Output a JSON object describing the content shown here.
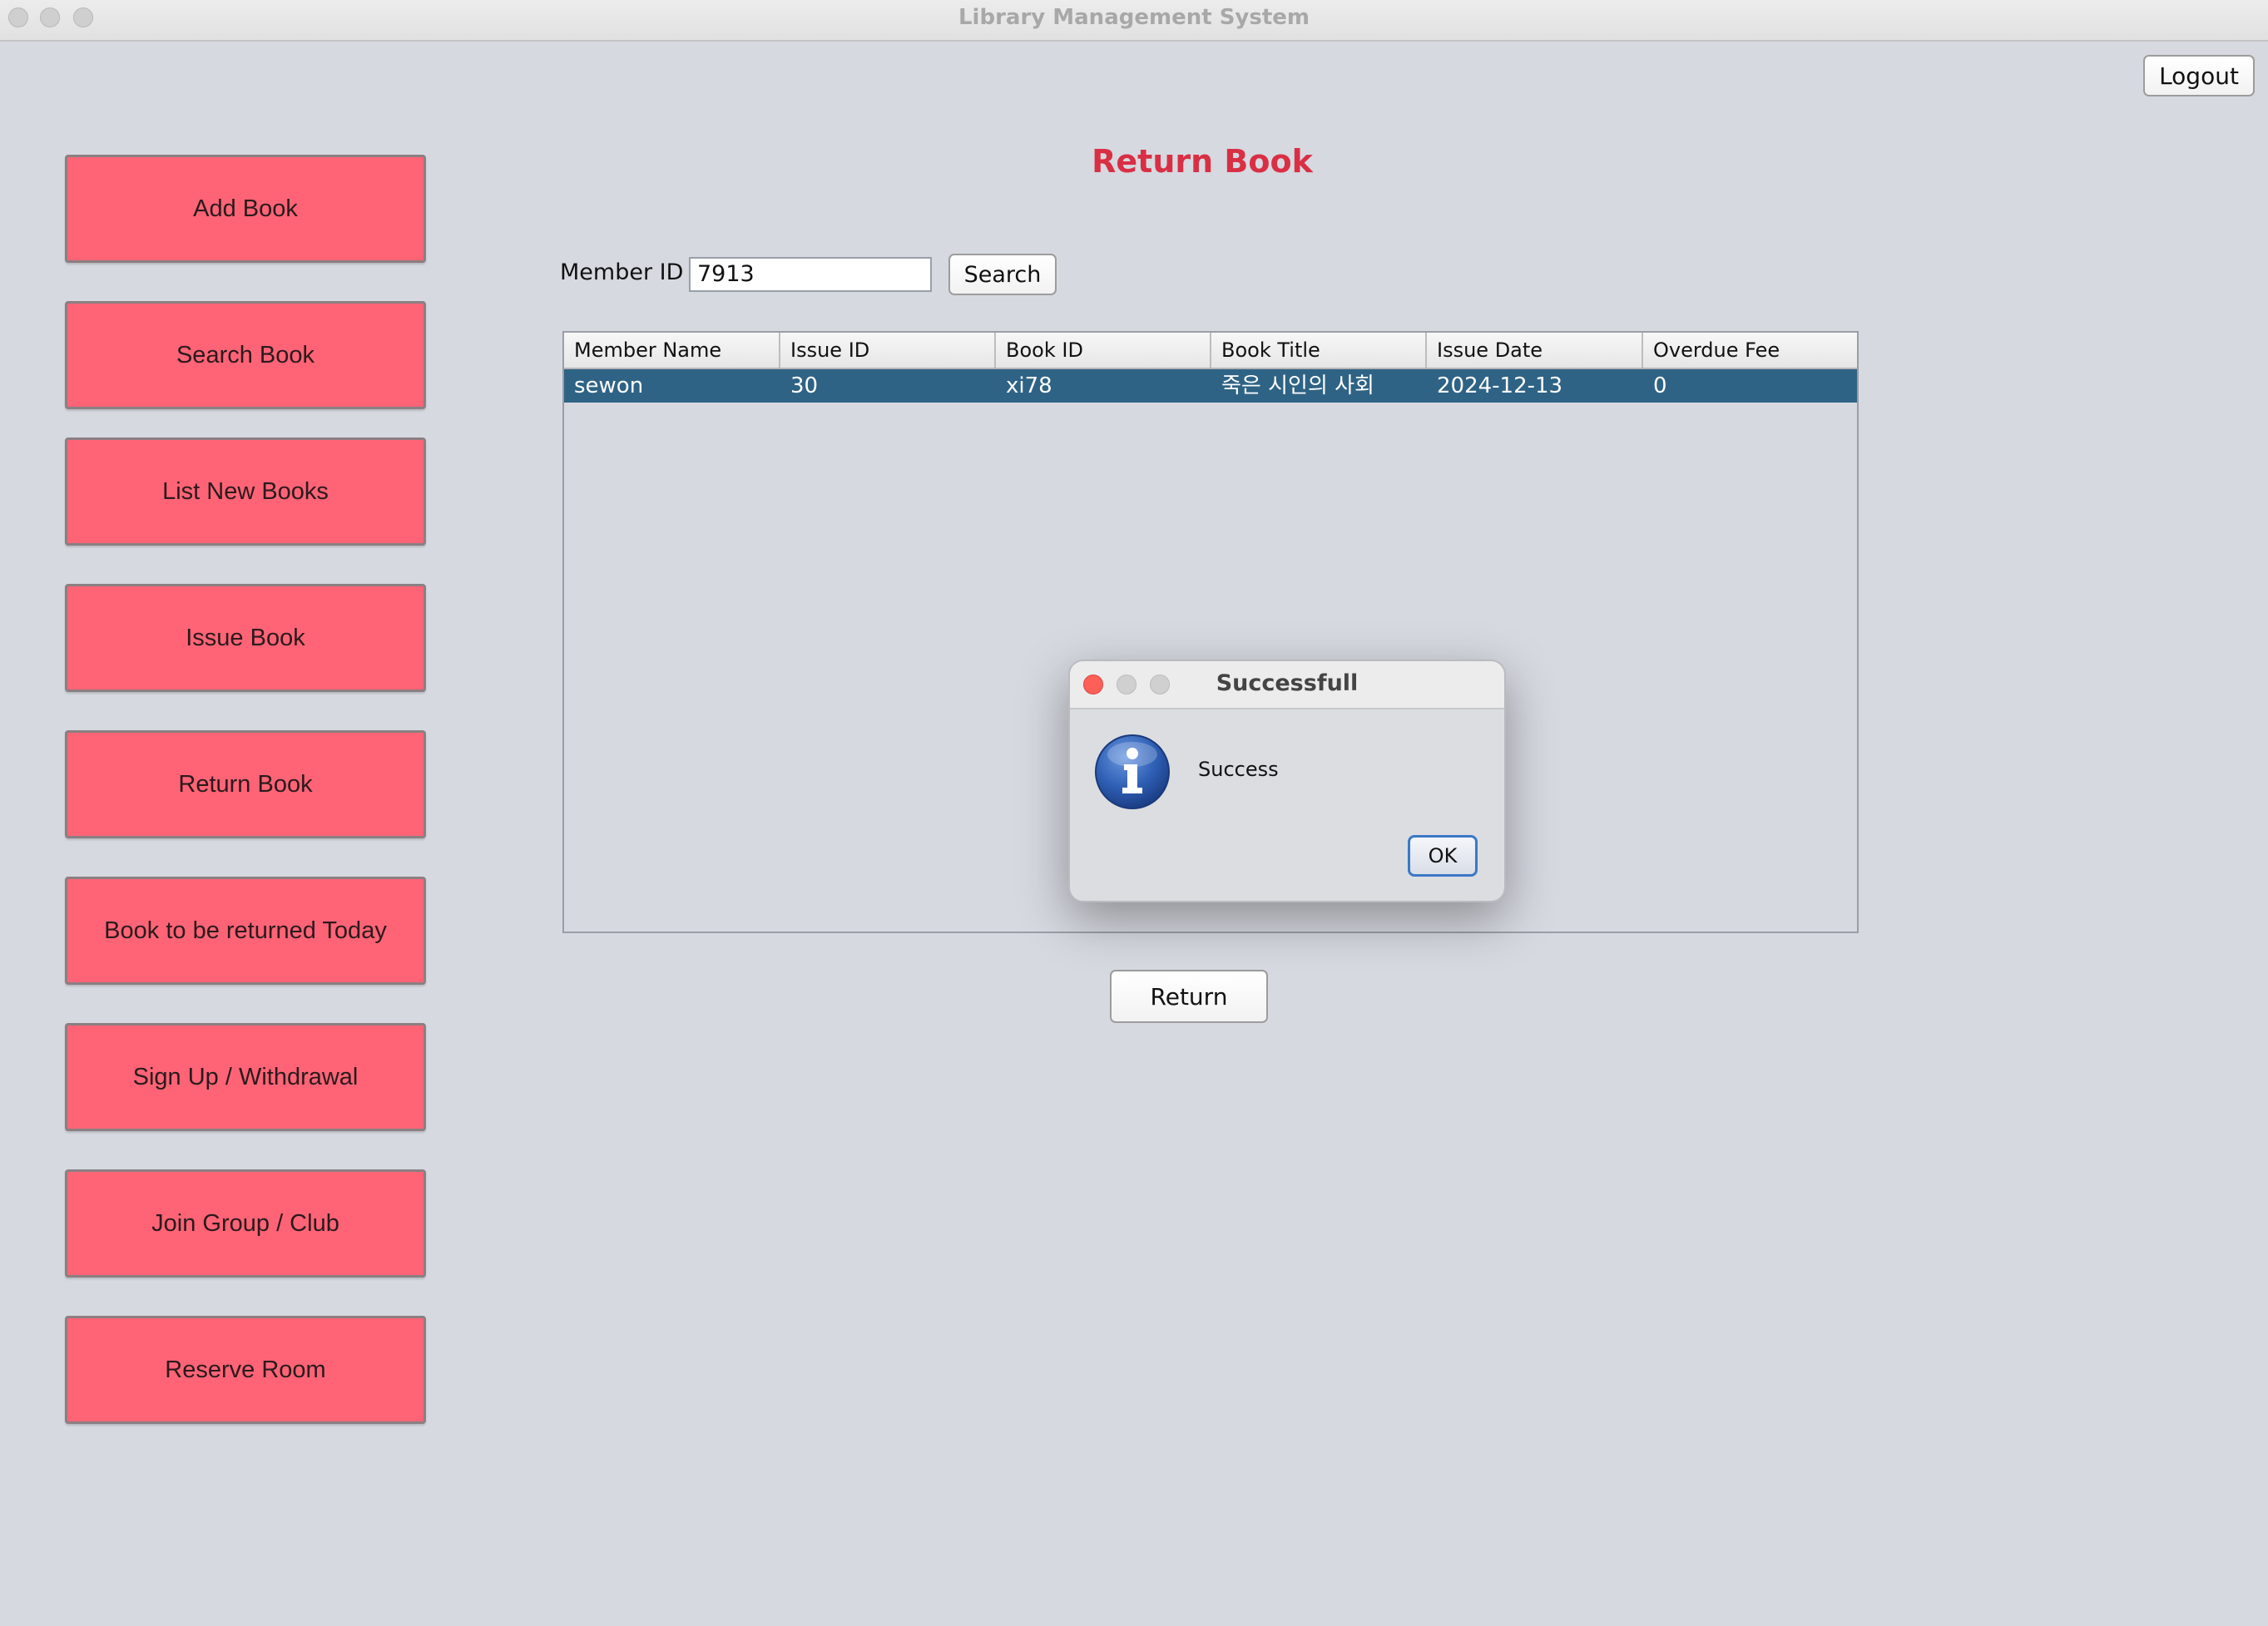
{
  "window": {
    "title": "Library Management System"
  },
  "header": {
    "logout_label": "Logout"
  },
  "sidebar": {
    "items": [
      {
        "label": "Add Book"
      },
      {
        "label": "Search Book"
      },
      {
        "label": "List New Books"
      },
      {
        "label": "Issue Book"
      },
      {
        "label": "Return Book"
      },
      {
        "label": "Book to be returned Today"
      },
      {
        "label": "Sign Up / Withdrawal"
      },
      {
        "label": "Join Group / Club"
      },
      {
        "label": "Reserve Room"
      }
    ],
    "button_color": "#fe6476"
  },
  "main": {
    "title": "Return Book",
    "title_color": "#d92f44",
    "member_id_label": "Member ID",
    "member_id_value": "7913",
    "search_label": "Search",
    "table": {
      "columns": [
        "Member Name",
        "Issue ID",
        "Book ID",
        "Book Title",
        "Issue Date",
        "Overdue Fee"
      ],
      "rows": [
        [
          "sewon",
          "30",
          "xi78",
          "죽은 시인의 사회",
          "2024-12-13",
          "0"
        ]
      ],
      "selected_row_color": "#2f6385"
    },
    "return_label": "Return"
  },
  "dialog": {
    "title": "Successfull",
    "message": "Success",
    "ok_label": "OK",
    "icon": "info-icon"
  }
}
